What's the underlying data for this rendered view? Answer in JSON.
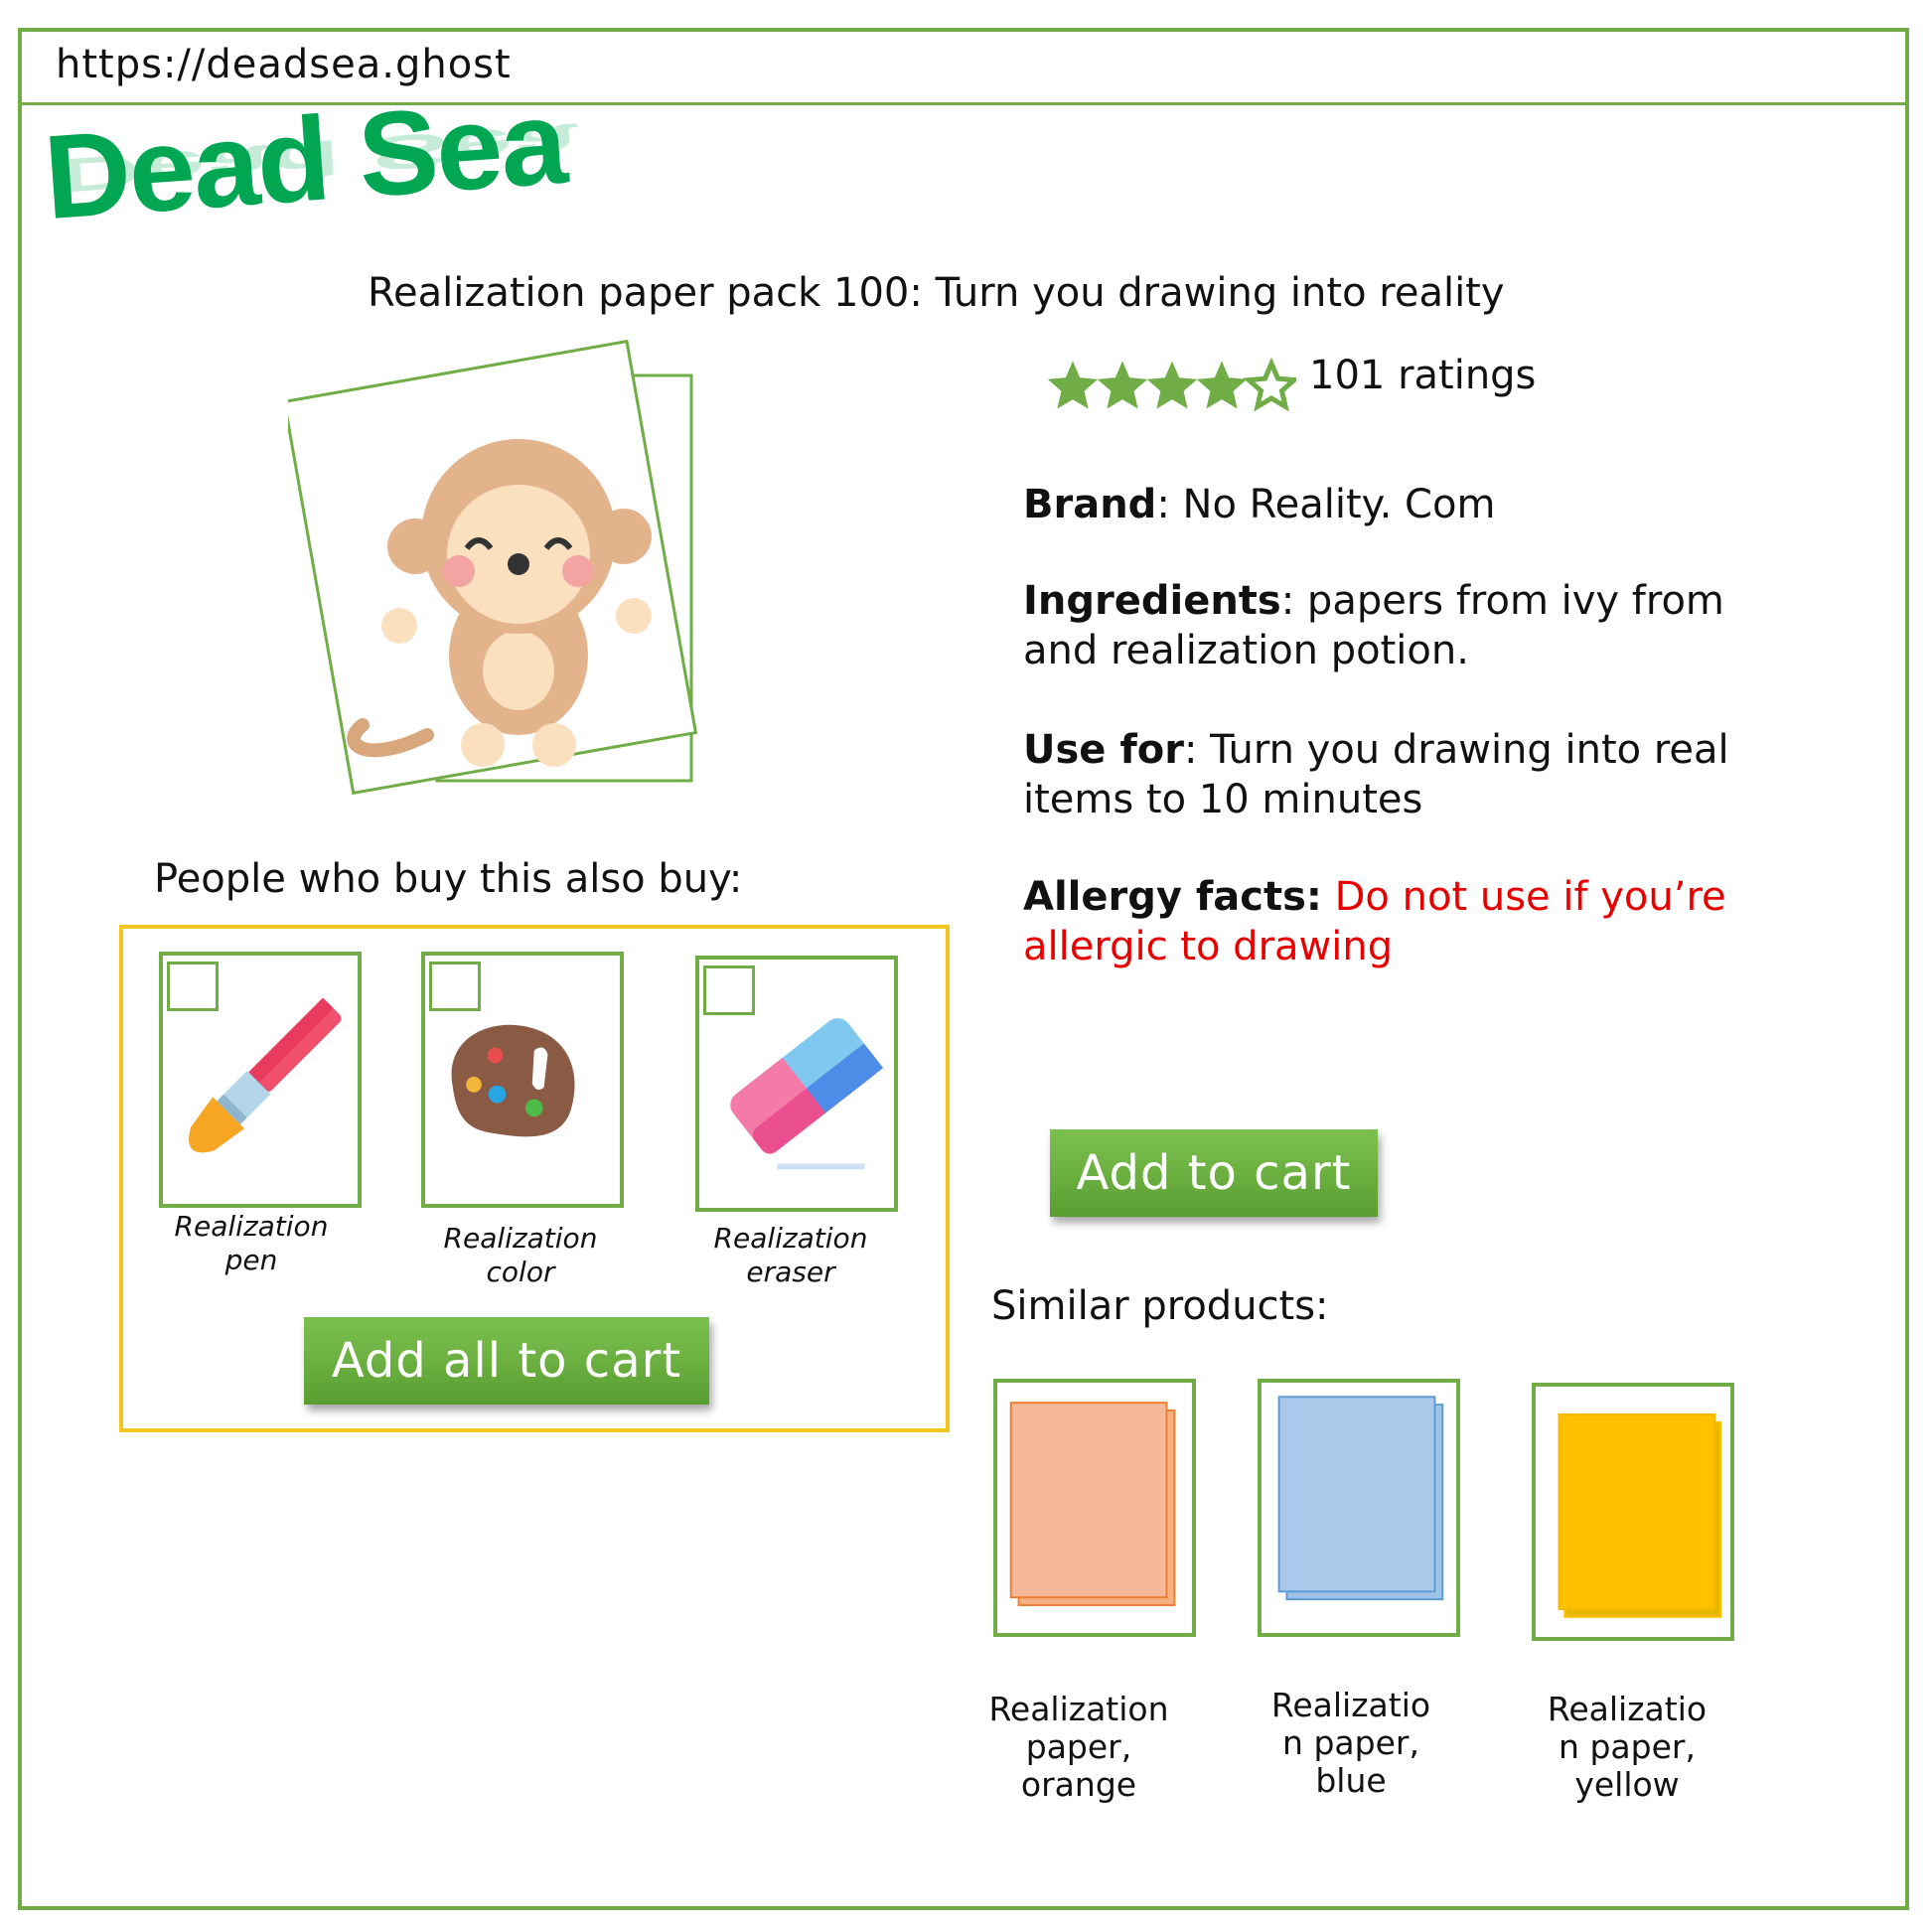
{
  "url": "https://deadsea.ghost",
  "brand_logo": "Dead Sea",
  "product": {
    "title": "Realization paper pack 100: Turn you drawing into reality",
    "image_icon": "monkey-drawing-icon",
    "rating": {
      "stars": 4,
      "max": 5,
      "count_label": "101 ratings"
    },
    "brand_key": "Brand",
    "brand_value": ": No Reality. Com",
    "ingredients_key": "Ingredients",
    "ingredients_value": ": papers from ivy from",
    "ingredients_value2": "and realization potion.",
    "usefor_key": "Use for",
    "usefor_value": ": Turn you drawing into real",
    "usefor_value2": "items to 10 minutes",
    "allergy_key": "Allergy facts:",
    "allergy_value": "Do not use if you’re",
    "allergy_value2": "allergic to drawing",
    "add_to_cart": "Add to cart"
  },
  "also_buy": {
    "label": "People who buy this also buy:",
    "items": [
      {
        "line1": "Realization",
        "line2": "pen",
        "icon": "paintbrush-icon"
      },
      {
        "line1": "Realization",
        "line2": "color",
        "icon": "palette-icon"
      },
      {
        "line1": "Realization",
        "line2": "eraser",
        "icon": "eraser-icon"
      }
    ],
    "add_all": "Add all to cart"
  },
  "similar": {
    "label": "Similar products:",
    "items": [
      {
        "line1": "Realization",
        "line2": "paper,",
        "line3": "orange",
        "color": "#f4b183"
      },
      {
        "line1": "Realizatio",
        "line2": "n paper,",
        "line3": "blue",
        "color": "#9dc3e6"
      },
      {
        "line1": "Realizatio",
        "line2": "n paper,",
        "line3": "yellow",
        "color": "#ffc000"
      }
    ]
  },
  "colors": {
    "accent": "#70ad47",
    "logo": "#00a651",
    "alert": "#e60000",
    "box": "#f4c41f"
  }
}
